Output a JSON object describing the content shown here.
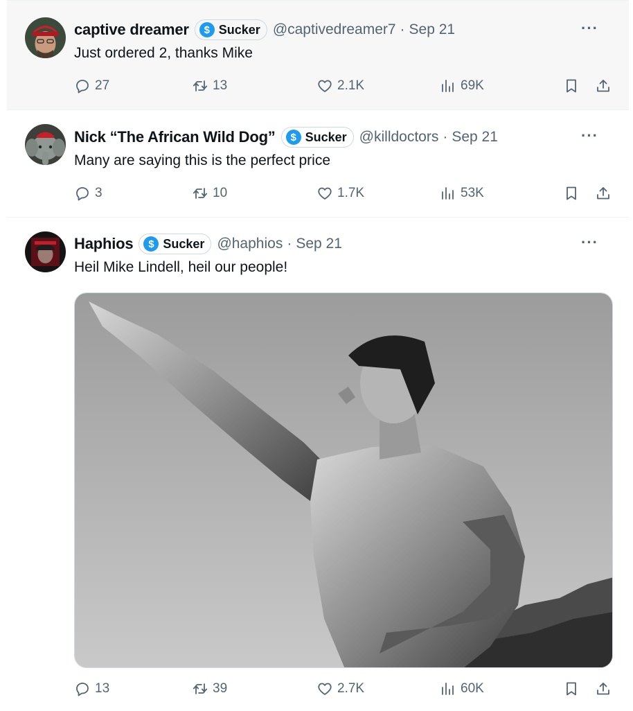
{
  "tweets": [
    {
      "name": "captive dreamer",
      "badge": "Sucker",
      "badge_icon": "$",
      "handle": "@captivedreamer7",
      "date": "Sep 21",
      "text": "Just ordered 2, thanks Mike",
      "replies": "27",
      "retweets": "13",
      "likes": "2.1K",
      "views": "69K",
      "more": "···"
    },
    {
      "name": "Nick “The African Wild Dog”",
      "badge": "Sucker",
      "badge_icon": "$",
      "handle": "@killdoctors",
      "date": "Sep 21",
      "text": "Many are saying this is the perfect price",
      "replies": "3",
      "retweets": "10",
      "likes": "1.7K",
      "views": "53K",
      "more": "···"
    },
    {
      "name": "Haphios",
      "badge": "Sucker",
      "badge_icon": "$",
      "handle": "@haphios",
      "date": "Sep 21",
      "text": "Heil Mike Lindell, heil our people!",
      "replies": "13",
      "retweets": "39",
      "likes": "2.7K",
      "views": "60K",
      "more": "···"
    }
  ],
  "separator": "·",
  "colors": {
    "accent": "#1d9bf0",
    "muted": "#536471",
    "text": "#0f1419",
    "highlight_bg": "#f7f7f7"
  }
}
